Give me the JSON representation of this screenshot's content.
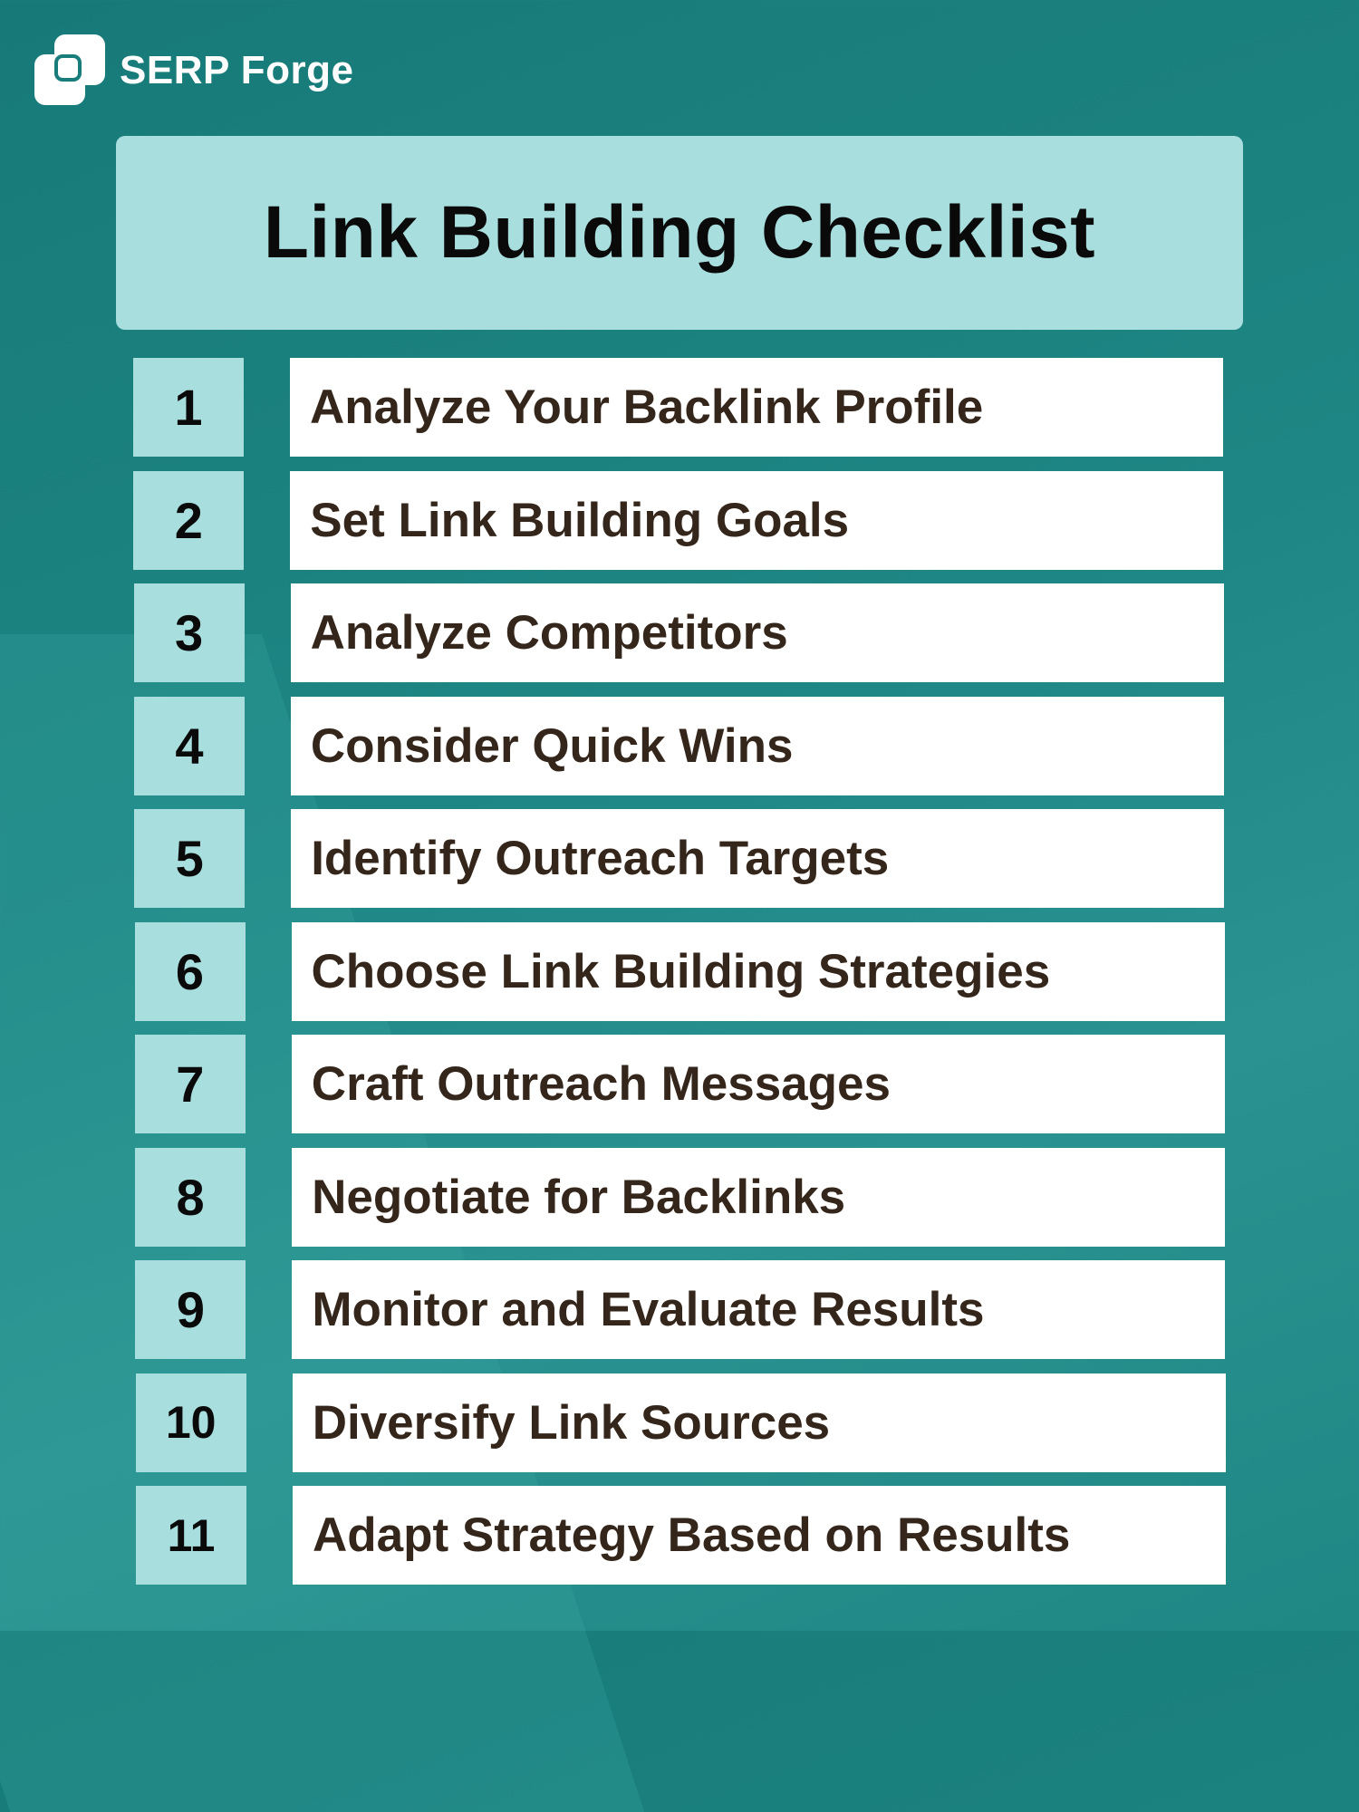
{
  "brand": {
    "name": "SERP Forge",
    "logo_icon": "overlapping-squares-icon"
  },
  "title": "Link Building Checklist",
  "colors": {
    "background": "#1e8684",
    "card": "#a8dede",
    "item_background": "#ffffff",
    "item_text": "#35261b",
    "title_text": "#0a0a0a"
  },
  "items": [
    {
      "number": "1",
      "label": "Analyze Your Backlink Profile"
    },
    {
      "number": "2",
      "label": "Set Link Building Goals"
    },
    {
      "number": "3",
      "label": "Analyze Competitors"
    },
    {
      "number": "4",
      "label": "Consider Quick Wins"
    },
    {
      "number": "5",
      "label": "Identify Outreach Targets"
    },
    {
      "number": "6",
      "label": "Choose Link Building Strategies"
    },
    {
      "number": "7",
      "label": "Craft Outreach Messages"
    },
    {
      "number": "8",
      "label": "Negotiate for Backlinks"
    },
    {
      "number": "9",
      "label": "Monitor and Evaluate Results"
    },
    {
      "number": "10",
      "label": "Diversify Link Sources"
    },
    {
      "number": "11",
      "label": "Adapt Strategy Based on Results"
    }
  ]
}
